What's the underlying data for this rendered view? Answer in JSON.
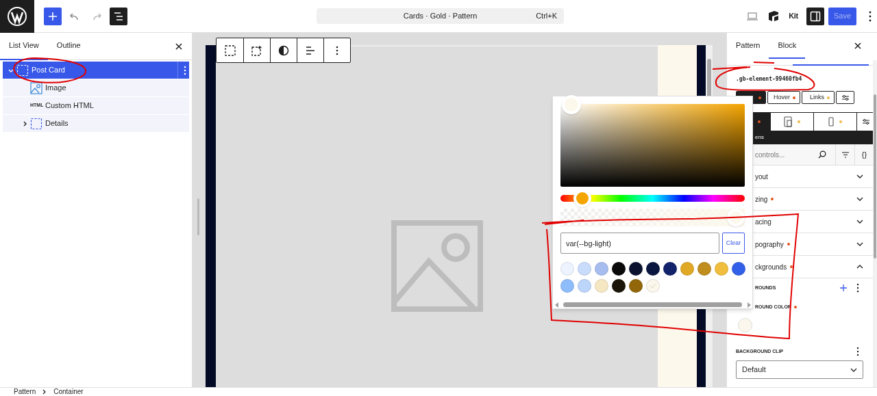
{
  "top_bar": {
    "list_view_toggle": {
      "selected": true
    },
    "undo": {
      "disabled": false
    },
    "redo": {
      "disabled": true
    },
    "command_bar": {
      "title": "Cards · Gold · Pattern",
      "shortcut": "Ctrl+K"
    },
    "kit_label": "Kit",
    "settings_toggle": {
      "selected": true
    },
    "save": {
      "label": "Save",
      "disabled": true
    }
  },
  "left_panel": {
    "tabs": [
      {
        "label": "List View",
        "selected": true
      },
      {
        "label": "Outline",
        "selected": false
      }
    ],
    "tree": [
      {
        "label": "Post Card",
        "kind": "group",
        "selected": true,
        "expanded": true,
        "children": [
          {
            "label": "Image",
            "kind": "image",
            "selected": false
          },
          {
            "label": "Custom HTML",
            "kind": "html",
            "badge": "HTML",
            "selected": false
          },
          {
            "label": "Details",
            "kind": "group",
            "selected": false,
            "expanded": false
          }
        ]
      }
    ]
  },
  "block_toolbar": {
    "buttons": [
      {
        "kind": "select"
      },
      {
        "kind": "add"
      },
      {
        "kind": "contrast"
      },
      {
        "kind": "align"
      },
      {
        "kind": "more"
      }
    ]
  },
  "color_picker": {
    "hue_slider": {
      "level": 0.08
    },
    "alpha_slider": {
      "level": 1
    },
    "value": "var(--bg-light)",
    "clear_label": "Clear",
    "swatches": [
      {
        "color": "#eef4ff",
        "selected": false
      },
      {
        "color": "#c9dcfb",
        "selected": false
      },
      {
        "color": "#a7bdf0",
        "selected": false
      },
      {
        "color": "#0a0a0a",
        "selected": false
      },
      {
        "color": "#0b1230",
        "selected": false
      },
      {
        "color": "#0b1640",
        "selected": false
      },
      {
        "color": "#12226b",
        "selected": false
      },
      {
        "color": "#e0a823",
        "selected": false
      },
      {
        "color": "#c08d1f",
        "selected": false
      },
      {
        "color": "#f0be3c",
        "selected": false
      },
      {
        "color": "#3360e8",
        "selected": false
      },
      {
        "color": "#8fbdfc",
        "selected": false
      },
      {
        "color": "#bcd5fb",
        "selected": false
      },
      {
        "color": "#f6e7c3",
        "selected": false
      },
      {
        "color": "#1a1508",
        "selected": false
      },
      {
        "color": "#916709",
        "selected": false
      },
      {
        "color": "#fbf7ec",
        "selected": true
      }
    ]
  },
  "right_panel": {
    "tabs": [
      {
        "label": "Pattern",
        "selected": false
      },
      {
        "label": "Block",
        "selected": true
      }
    ],
    "selector": ".gb-element-99460fb4",
    "state_tabs": [
      {
        "kind": "default",
        "selected": true,
        "color": "#e0541e"
      },
      {
        "kind": "label",
        "label": "Hover",
        "selected": false,
        "color": "#e0541e"
      },
      {
        "kind": "label",
        "label": "Links",
        "selected": false,
        "color": "#f0b849"
      },
      {
        "kind": "settings"
      }
    ],
    "device_tabs": [
      {
        "kind": "desktop",
        "selected": true,
        "color": "#e0541e"
      },
      {
        "kind": "tablet",
        "selected": false,
        "color": "#f0b849"
      },
      {
        "kind": "mobile",
        "selected": false,
        "color": "#f0b849"
      },
      {
        "kind": "settings"
      }
    ],
    "screens_label": "ens",
    "search": {
      "placeholder": "controls..."
    },
    "code_label": "{}",
    "panels": [
      {
        "label": "yout",
        "modified": false,
        "expanded": false
      },
      {
        "label": "zing",
        "modified": true,
        "expanded": false
      },
      {
        "label": "acing",
        "modified": false,
        "expanded": false
      },
      {
        "label": "pography",
        "modified": true,
        "expanded": false
      },
      {
        "label": "ckgrounds",
        "modified": true,
        "expanded": true
      }
    ],
    "backgrounds": {
      "list_label": "ROUNDS",
      "color_label": "ROUND COLOR",
      "color_modified": true,
      "clip_label": "BACKGROUND CLIP",
      "clip_value": "Default"
    }
  },
  "breadcrumb": [
    "Pattern",
    "Container"
  ]
}
